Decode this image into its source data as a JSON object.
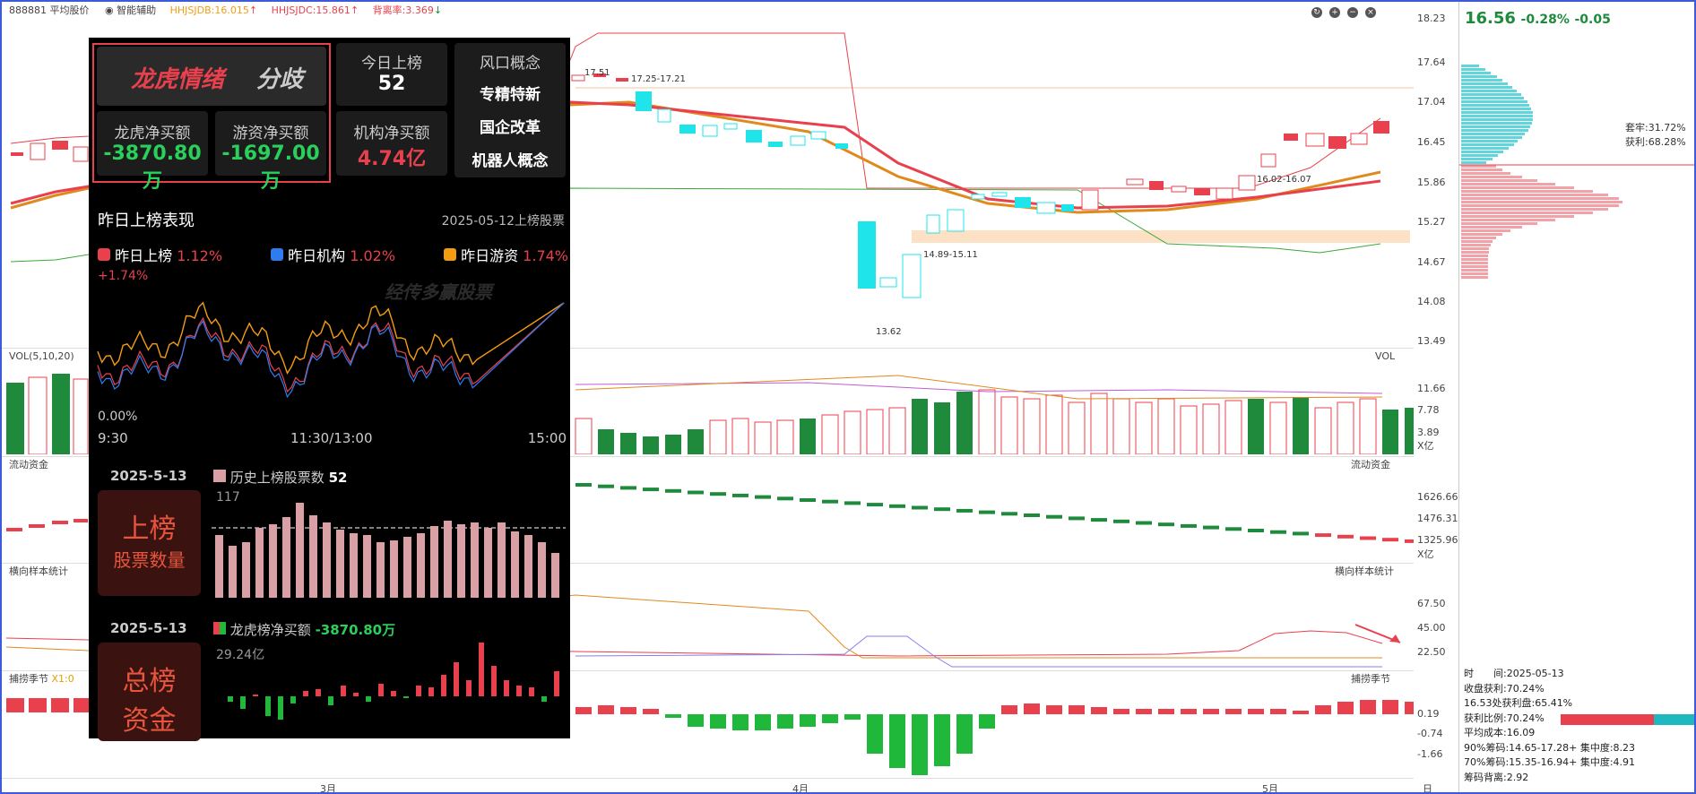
{
  "header": {
    "code": "888881 平均股价",
    "assist": "智能辅助",
    "i1": "HHJSJDB:16.015",
    "i2": "HHJSJDC:15.861",
    "i3": "背离率:3.369"
  },
  "price_axis": [
    "18.23",
    "17.64",
    "17.04",
    "16.45",
    "15.86",
    "15.27",
    "14.67",
    "14.08",
    "13.49"
  ],
  "annotations": {
    "a1": "17.51",
    "a2": "17.25-17.21",
    "a3": "14.89-15.11",
    "a4": "13.62",
    "a5": "16.02-16.07"
  },
  "vol": {
    "label": "VOL(5,10,20)",
    "right": "VOL",
    "axis": [
      "11.66",
      "7.78",
      "3.89",
      "X亿"
    ]
  },
  "flow": {
    "label": "流动资金",
    "right": "流动资金",
    "axis": [
      "1626.66",
      "1476.31",
      "1325.96",
      "X亿"
    ]
  },
  "sample": {
    "label": "横向样本统计",
    "right": "横向样本统计",
    "axis": [
      "67.50",
      "45.00",
      "22.50"
    ]
  },
  "season": {
    "label": "捕捞季节",
    "x1": "X1:0",
    "right": "捕捞季节",
    "axis": [
      "0.19",
      "-0.74",
      "-1.66"
    ]
  },
  "months": [
    "3月",
    "4月",
    "5月"
  ],
  "period": "日线",
  "right_panel": {
    "price": "16.56",
    "chg": "-0.28%",
    "amt": "-0.05",
    "trap": "套牢:31.72%",
    "profit": "获利:68.28%",
    "info": [
      "时　　间:2025-05-13",
      "收盘获利:70.24%",
      "16.53处获利盘:65.41%",
      "获利比例:70.24%",
      "平均成本:16.09",
      "90%筹码:14.65-17.28+ 集中度:8.23",
      "70%筹码:15.35-16.94+ 集中度:4.91",
      "筹码背离:2.92"
    ]
  },
  "overlay": {
    "brand1": "龙虎情绪",
    "brand2": "分歧",
    "today_title": "今日上榜",
    "today_value": "52",
    "wind_title": "风口概念",
    "concepts": [
      "专精特新",
      "国企改革",
      "机器人概念"
    ],
    "lh_title": "龙虎净买额",
    "lh_value": "-3870.80万",
    "yz_title": "游资净买额",
    "yz_value": "-1697.00万",
    "jg_title": "机构净买额",
    "jg_value": "4.74亿",
    "yest_title": "昨日上榜表现",
    "yest_date": "2025-05-12上榜股票",
    "leg1": "昨日上榜",
    "leg1v": "1.12%",
    "leg2": "昨日机构",
    "leg2v": "1.02%",
    "leg3": "昨日游资",
    "leg3v": "1.74%",
    "ytop": "+1.74%",
    "ybot": "0.00%",
    "watermark": "经传多赢股票",
    "t1": "9:30",
    "t2": "11:30/13:00",
    "t3": "15:00",
    "date1": "2025-5-13",
    "hist_label": "历史上榜股票数",
    "hist_value": "52",
    "box1a": "上榜",
    "box1b": "股票数量",
    "hist_max": "117",
    "date2": "2025-5-13",
    "net_label": "龙虎榜净买额",
    "net_value": "-3870.80万",
    "box2a": "总榜",
    "box2b": "资金",
    "net_max": "29.24亿"
  },
  "colors": {
    "up": "#e8414d",
    "down": "#1f8a3b",
    "cyan": "#1fe4ea",
    "orange": "#f39c12"
  }
}
